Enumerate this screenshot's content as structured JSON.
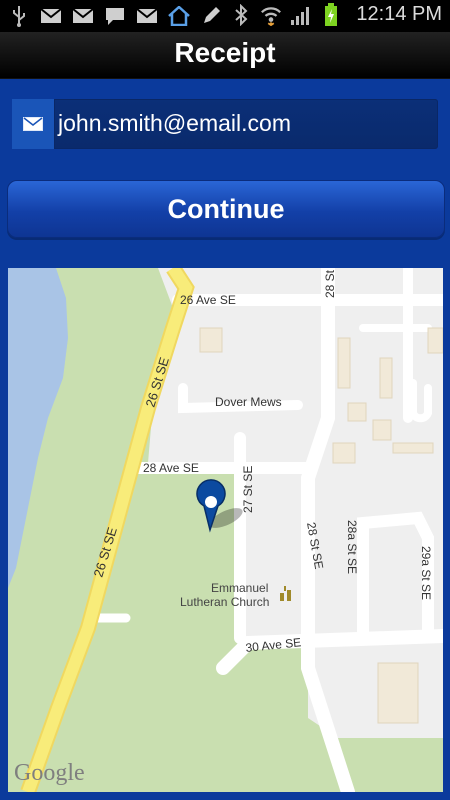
{
  "status_bar": {
    "time": "12:14 PM",
    "icons": [
      "usb-icon",
      "gmail-icon",
      "gmail-icon",
      "chat-icon",
      "gmail-icon",
      "home-icon",
      "edit-icon",
      "bluetooth-icon",
      "wifi-icon",
      "signal-icon",
      "battery-icon"
    ]
  },
  "header": {
    "title": "Receipt"
  },
  "form": {
    "email_value": "john.smith@email.com",
    "continue_label": "Continue"
  },
  "map": {
    "labels": {
      "ave26": "26 Ave SE",
      "ave28": "28 Ave SE",
      "ave30": "30 Ave SE",
      "dover": "Dover Mews",
      "st26_top": "26 St SE",
      "st26_bottom": "26 St SE",
      "st27": "27 St SE",
      "st28_top": "28 St",
      "st28_mid": "28 St SE",
      "st28a": "28a St SE",
      "st29a": "29a St SE",
      "church_line1": "Emmanuel",
      "church_line2": "Lutheran Church",
      "brand": "Google"
    },
    "colors": {
      "park": "#c9dfb0",
      "river": "#a9c4e6",
      "highway": "#f8ec7a",
      "marker": "#0b4aa0"
    }
  }
}
